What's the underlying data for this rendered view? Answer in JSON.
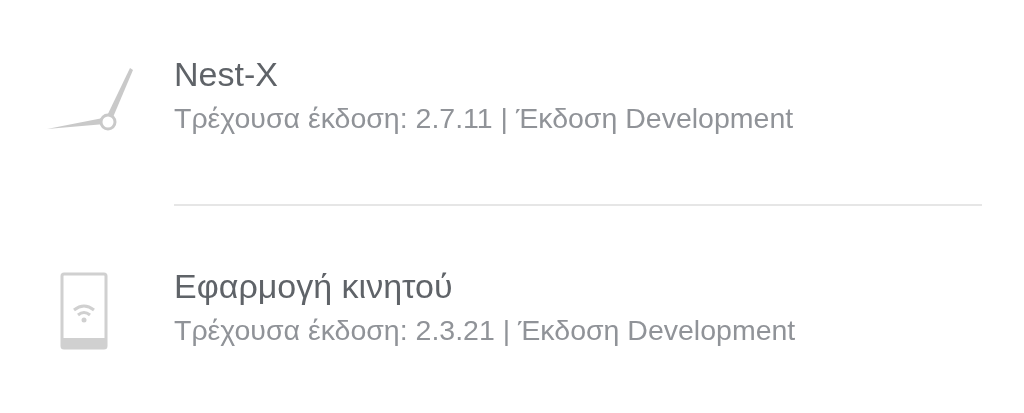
{
  "items": [
    {
      "kind": "clock",
      "title": "Nest-X",
      "subtitle": "Τρέχουσα έκδοση: 2.7.11 | Έκδοση Development"
    },
    {
      "kind": "phone",
      "title": "Εφαρμογή κινητού",
      "subtitle": "Τρέχουσα έκδοση: 2.3.21 | Έκδοση Development"
    }
  ]
}
